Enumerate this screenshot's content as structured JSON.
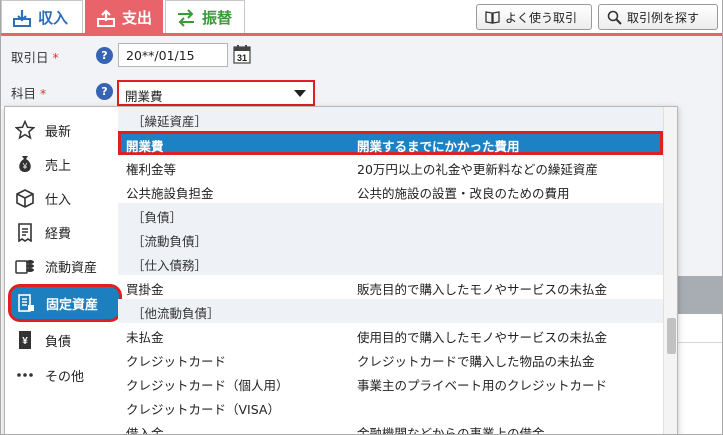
{
  "tabs": {
    "income": "収入",
    "expense": "支出",
    "transfer": "振替"
  },
  "toolbar": {
    "frequent": "よく使う取引",
    "examples": "取引例を探す"
  },
  "form": {
    "date_label": "取引日",
    "subject_label": "科目",
    "required_mark": "*",
    "help_glyph": "?",
    "date_value": "20**/01/15",
    "calendar_day": "31",
    "subject_value": "開業費"
  },
  "categories": [
    {
      "label": "最新",
      "icon": "star-icon"
    },
    {
      "label": "売上",
      "icon": "money-bag-icon"
    },
    {
      "label": "仕入",
      "icon": "box-icon"
    },
    {
      "label": "経費",
      "icon": "receipt-icon"
    },
    {
      "label": "流動資産",
      "icon": "coins-icon"
    },
    {
      "label": "固定資産",
      "icon": "building-icon"
    },
    {
      "label": "負債",
      "icon": "yen-book-icon"
    },
    {
      "label": "その他",
      "icon": "dots-icon"
    }
  ],
  "options": [
    {
      "type": "header",
      "name": "［繰延資産］",
      "desc": ""
    },
    {
      "type": "selected",
      "name": "開業費",
      "desc": "開業するまでにかかった費用"
    },
    {
      "type": "item",
      "name": "権利金等",
      "desc": "20万円以上の礼金や更新料などの繰延資産"
    },
    {
      "type": "item",
      "name": "公共施設負担金",
      "desc": "公共的施設の設置・改良のための費用"
    },
    {
      "type": "header",
      "name": "［負債］",
      "desc": ""
    },
    {
      "type": "header",
      "name": "［流動負債］",
      "desc": ""
    },
    {
      "type": "header",
      "name": "［仕入債務］",
      "desc": ""
    },
    {
      "type": "item",
      "name": "買掛金",
      "desc": "販売目的で購入したモノやサービスの未払金"
    },
    {
      "type": "header",
      "name": "［他流動負債］",
      "desc": ""
    },
    {
      "type": "item",
      "name": "未払金",
      "desc": "使用目的で購入したモノやサービスの未払金"
    },
    {
      "type": "item",
      "name": "クレジットカード",
      "desc": "クレジットカードで購入した物品の未払金"
    },
    {
      "type": "item",
      "name": "クレジットカード（個人用）",
      "desc": "事業主のプライベート用のクレジットカード"
    },
    {
      "type": "item",
      "name": "クレジットカード（VISA）",
      "desc": ""
    },
    {
      "type": "item",
      "name": "借入金",
      "desc": "金融機関などからの事業上の借金"
    }
  ],
  "colors": {
    "accent_red": "#e8646a",
    "income_blue": "#2f6fb6",
    "transfer_green": "#3a9a3a",
    "selection_blue": "#1d82c4",
    "highlight_red": "#e02020"
  },
  "scroll": {
    "position": 0.72
  }
}
